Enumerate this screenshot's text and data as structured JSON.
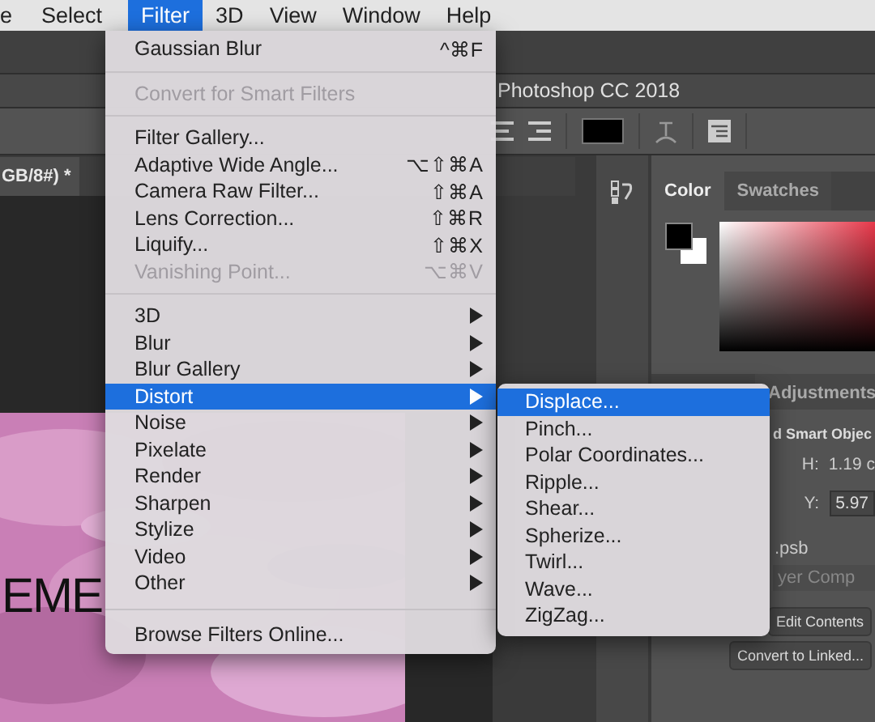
{
  "menubar": [
    {
      "label": "e",
      "selected": false
    },
    {
      "label": "Select",
      "selected": false
    },
    {
      "label": "Filter",
      "selected": true
    },
    {
      "label": "3D",
      "selected": false
    },
    {
      "label": "View",
      "selected": false
    },
    {
      "label": "Window",
      "selected": false
    },
    {
      "label": "Help",
      "selected": false
    }
  ],
  "app_title": "Photoshop CC 2018",
  "doc_tab": "GB/8#) *",
  "canvas_text": "EME",
  "color_panel": {
    "tabs": [
      {
        "label": "Color",
        "selected": true
      },
      {
        "label": "Swatches",
        "selected": false
      }
    ]
  },
  "properties_panel": {
    "adjustments_tab": "Adjustments",
    "heading": "d Smart Objec",
    "h_label": "H:",
    "h_value": "1.19 c",
    "y_label": "Y:",
    "y_value": "5.97",
    "file": ".psb",
    "layer_comp": "yer Comp",
    "buttons": [
      "Edit Contents",
      "Convert to Linked..."
    ]
  },
  "filter_menu": {
    "groups": [
      [
        {
          "label": "Gaussian Blur",
          "shortcut": "^⌘F",
          "disabled": false,
          "submenu": false,
          "selected": false
        }
      ],
      [
        {
          "label": "Convert for Smart Filters",
          "disabled": true,
          "submenu": false,
          "selected": false
        }
      ],
      [
        {
          "label": "Filter Gallery...",
          "disabled": false,
          "submenu": false,
          "selected": false
        },
        {
          "label": "Adaptive Wide Angle...",
          "shortcut": "⌥⇧⌘A",
          "disabled": false,
          "submenu": false,
          "selected": false
        },
        {
          "label": "Camera Raw Filter...",
          "shortcut": "⇧⌘A",
          "disabled": false,
          "submenu": false,
          "selected": false
        },
        {
          "label": "Lens Correction...",
          "shortcut": "⇧⌘R",
          "disabled": false,
          "submenu": false,
          "selected": false
        },
        {
          "label": "Liquify...",
          "shortcut": "⇧⌘X",
          "disabled": false,
          "submenu": false,
          "selected": false
        },
        {
          "label": "Vanishing Point...",
          "shortcut": "⌥⌘V",
          "disabled": true,
          "submenu": false,
          "selected": false
        }
      ],
      [
        {
          "label": "3D",
          "disabled": false,
          "submenu": true,
          "selected": false
        },
        {
          "label": "Blur",
          "disabled": false,
          "submenu": true,
          "selected": false
        },
        {
          "label": "Blur Gallery",
          "disabled": false,
          "submenu": true,
          "selected": false
        },
        {
          "label": "Distort",
          "disabled": false,
          "submenu": true,
          "selected": true
        },
        {
          "label": "Noise",
          "disabled": false,
          "submenu": true,
          "selected": false
        },
        {
          "label": "Pixelate",
          "disabled": false,
          "submenu": true,
          "selected": false
        },
        {
          "label": "Render",
          "disabled": false,
          "submenu": true,
          "selected": false
        },
        {
          "label": "Sharpen",
          "disabled": false,
          "submenu": true,
          "selected": false
        },
        {
          "label": "Stylize",
          "disabled": false,
          "submenu": true,
          "selected": false
        },
        {
          "label": "Video",
          "disabled": false,
          "submenu": true,
          "selected": false
        },
        {
          "label": "Other",
          "disabled": false,
          "submenu": true,
          "selected": false
        }
      ],
      [
        {
          "label": "Browse Filters Online...",
          "disabled": false,
          "submenu": false,
          "selected": false
        }
      ]
    ]
  },
  "distort_submenu": [
    {
      "label": "Displace...",
      "selected": true
    },
    {
      "label": "Pinch...",
      "selected": false
    },
    {
      "label": "Polar Coordinates...",
      "selected": false
    },
    {
      "label": "Ripple...",
      "selected": false
    },
    {
      "label": "Shear...",
      "selected": false
    },
    {
      "label": "Spherize...",
      "selected": false
    },
    {
      "label": "Twirl...",
      "selected": false
    },
    {
      "label": "Wave...",
      "selected": false
    },
    {
      "label": "ZigZag...",
      "selected": false
    }
  ]
}
